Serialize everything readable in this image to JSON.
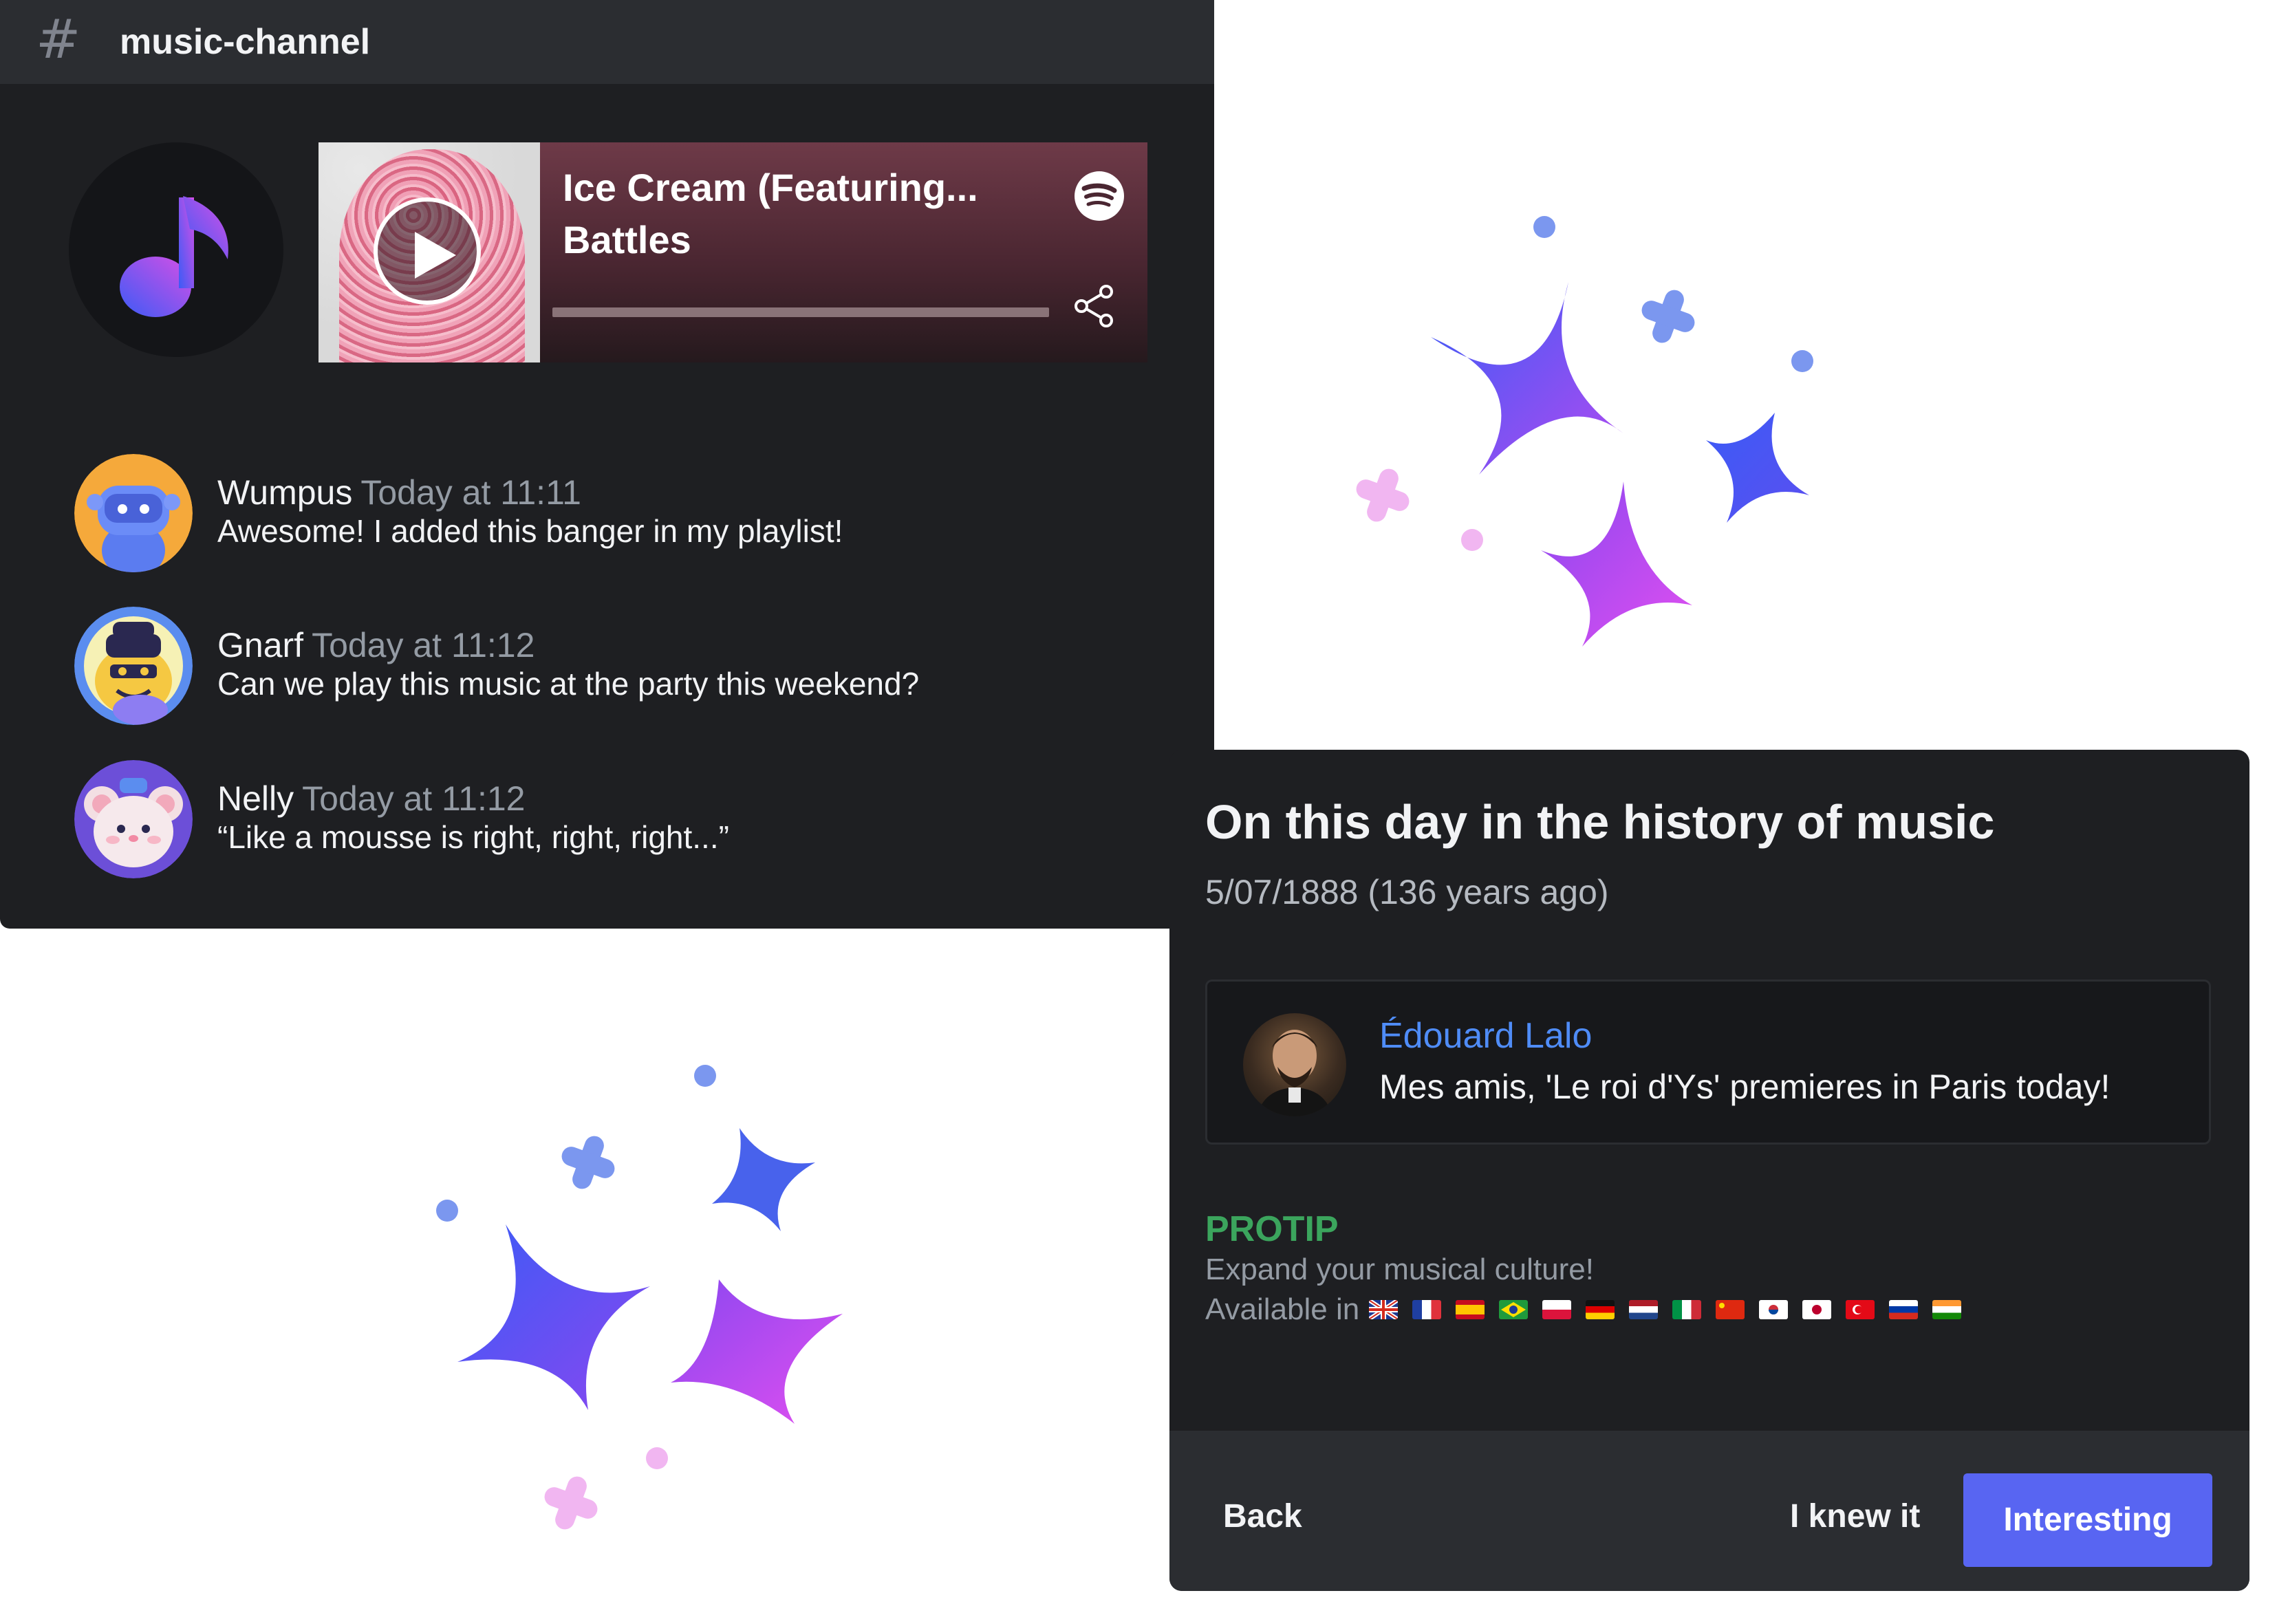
{
  "channel": {
    "name": "music-channel",
    "hash_icon": "hash-icon",
    "music_icon": "music-note-icon",
    "player": {
      "title": "Ice Cream (Featuring...",
      "artist": "Battles",
      "progress": 0,
      "play_icon": "play-icon",
      "spotify_icon": "spotify-icon",
      "share_icon": "share-icon"
    },
    "messages": [
      {
        "author": "Wumpus",
        "time": "Today at 11:11",
        "text": "Awesome! I added this banger in my playlist!"
      },
      {
        "author": "Gnarf",
        "time": "Today at 11:12",
        "text": "Can we play this music at the party this weekend?"
      },
      {
        "author": "Nelly",
        "time": "Today at 11:12",
        "text": "“Like a mousse is right, right, right...”"
      }
    ]
  },
  "history": {
    "title": "On this day in the history of music",
    "date": "5/07/1888 (136 years ago)",
    "quote": {
      "name": "Édouard Lalo",
      "text": "Mes amis, 'Le roi d'Ys' premieres in Paris today!"
    },
    "protip": {
      "label": "PROTIP",
      "text": "Expand your musical culture!",
      "available": "Available in",
      "flags": [
        "gb",
        "fr",
        "es",
        "br",
        "pl",
        "de",
        "nl",
        "it",
        "cn",
        "kr",
        "jp",
        "tr",
        "ru",
        "in"
      ]
    },
    "buttons": {
      "back": "Back",
      "knew": "I knew it",
      "interesting": "Interesting"
    }
  },
  "colors": {
    "accent": "#5865f2",
    "link": "#4f8cf7",
    "protip": "#3ba55d",
    "panel": "#1e1f22"
  }
}
